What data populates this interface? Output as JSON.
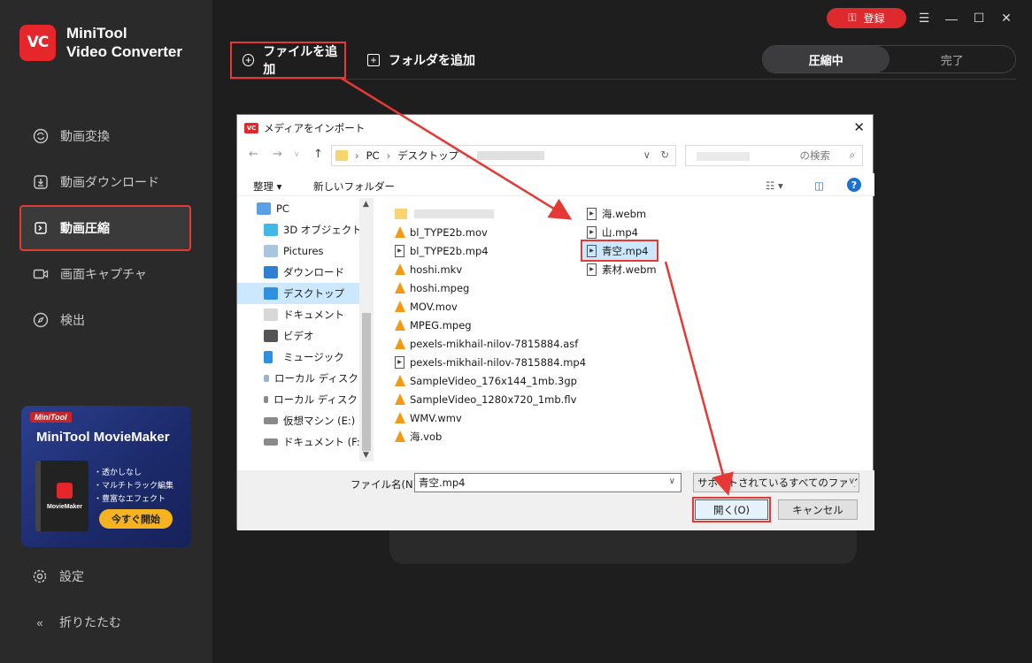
{
  "app": {
    "name_line1": "MiniTool",
    "name_line2": "Video Converter",
    "logo_text": "VC"
  },
  "sidebar": {
    "items": [
      {
        "label": "動画変換",
        "icon": "convert-icon"
      },
      {
        "label": "動画ダウンロード",
        "icon": "download-icon"
      },
      {
        "label": "動画圧縮",
        "icon": "compress-icon",
        "active": true
      },
      {
        "label": "画面キャプチャ",
        "icon": "camera-icon"
      },
      {
        "label": "検出",
        "icon": "compass-icon"
      }
    ],
    "promo": {
      "badge": "MiniTool",
      "title": "MiniTool MovieMaker",
      "box_title": "MovieMaker",
      "features": [
        "・透かしなし",
        "・マルチトラック編集",
        "・豊富なエフェクト"
      ],
      "button": "今すぐ開始"
    },
    "settings": "設定",
    "collapse": "折りたたむ"
  },
  "header": {
    "register": "登録",
    "add_file": "ファイルを追加",
    "add_folder": "フォルダを追加",
    "tabs": [
      "圧縮中",
      "完了"
    ]
  },
  "dialog": {
    "title": "メディアをインポート",
    "breadcrumb": [
      "PC",
      "デスクトップ"
    ],
    "search_placeholder": "の検索",
    "organize": "整理 ▾",
    "new_folder": "新しいフォルダー",
    "tree": [
      "PC",
      "3D オブジェクト",
      "Pictures",
      "ダウンロード",
      "デスクトップ",
      "ドキュメント",
      "ビデオ",
      "ミュージック",
      "ローカル ディスク (C",
      "ローカル ディスク (D",
      "仮想マシン (E:)",
      "ドキュメント (F:)"
    ],
    "files_col1": [
      "bl_TYPE2b.mov",
      "bl_TYPE2b.mp4",
      "hoshi.mkv",
      "hoshi.mpeg",
      "MOV.mov",
      "MPEG.mpeg",
      "pexels-mikhail-nilov-7815884.asf",
      "pexels-mikhail-nilov-7815884.mp4",
      "SampleVideo_176x144_1mb.3gp",
      "SampleVideo_1280x720_1mb.flv",
      "WMV.wmv",
      "海.vob"
    ],
    "files_col2": [
      "海.webm",
      "山.mp4",
      "青空.mp4",
      "素材.webm"
    ],
    "filename_label": "ファイル名(N):",
    "filename_value": "青空.mp4",
    "filetype": "サポートされているすべてのファイル (",
    "open": "開く(O)",
    "cancel": "キャンセル"
  },
  "colors": {
    "accent": "#e5262a",
    "highlight": "#e53935",
    "selection": "#cce8ff"
  }
}
